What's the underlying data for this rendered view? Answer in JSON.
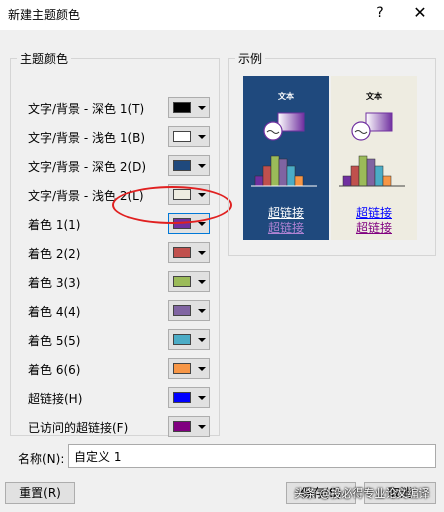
{
  "dialog": {
    "title": "新建主题颜色",
    "help_label": "?",
    "close_label": "✕"
  },
  "theme_group": {
    "legend": "主题颜色",
    "rows": [
      {
        "label": "文字/背景 - 深色 1(T)",
        "color": "#000000"
      },
      {
        "label": "文字/背景 - 浅色 1(B)",
        "color": "#ffffff"
      },
      {
        "label": "文字/背景 - 深色 2(D)",
        "color": "#1f497d"
      },
      {
        "label": "文字/背景 - 浅色 2(L)",
        "color": "#eeece1"
      },
      {
        "label": "着色 1(1)",
        "color": "#7030a0"
      },
      {
        "label": "着色 2(2)",
        "color": "#c0504d"
      },
      {
        "label": "着色 3(3)",
        "color": "#9bbb59"
      },
      {
        "label": "着色 4(4)",
        "color": "#8064a2"
      },
      {
        "label": "着色 5(5)",
        "color": "#4bacc6"
      },
      {
        "label": "着色 6(6)",
        "color": "#f79646"
      },
      {
        "label": "超链接(H)",
        "color": "#0000ff"
      },
      {
        "label": "已访问的超链接(F)",
        "color": "#800080"
      }
    ]
  },
  "sample": {
    "legend": "示例",
    "text": "文本",
    "hyperlink": "超链接",
    "visited_hyperlink": "超链接",
    "link_colors": {
      "dark": {
        "link": "#ffffff",
        "visited": "#b083d4"
      },
      "light": {
        "link": "#0000ff",
        "visited": "#800080"
      }
    },
    "chart_colors": [
      "#7030a0",
      "#c0504d",
      "#9bbb59",
      "#8064a2",
      "#4bacc6",
      "#f79646"
    ]
  },
  "name_field": {
    "label": "名称(N):",
    "value": "自定义 1"
  },
  "buttons": {
    "reset": "重置(R)",
    "save": "保存(S)",
    "cancel": "取消"
  },
  "watermark": "头条 @投必得专业论文编译"
}
